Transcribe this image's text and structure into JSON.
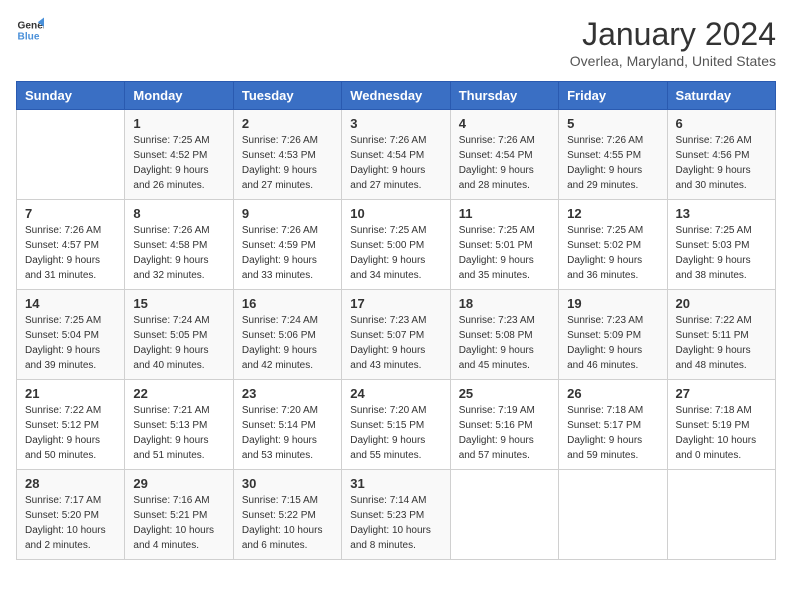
{
  "logo": {
    "line1": "General",
    "line2": "Blue"
  },
  "title": "January 2024",
  "subtitle": "Overlea, Maryland, United States",
  "days_of_week": [
    "Sunday",
    "Monday",
    "Tuesday",
    "Wednesday",
    "Thursday",
    "Friday",
    "Saturday"
  ],
  "weeks": [
    [
      {
        "day": "",
        "info": ""
      },
      {
        "day": "1",
        "info": "Sunrise: 7:25 AM\nSunset: 4:52 PM\nDaylight: 9 hours\nand 26 minutes."
      },
      {
        "day": "2",
        "info": "Sunrise: 7:26 AM\nSunset: 4:53 PM\nDaylight: 9 hours\nand 27 minutes."
      },
      {
        "day": "3",
        "info": "Sunrise: 7:26 AM\nSunset: 4:54 PM\nDaylight: 9 hours\nand 27 minutes."
      },
      {
        "day": "4",
        "info": "Sunrise: 7:26 AM\nSunset: 4:54 PM\nDaylight: 9 hours\nand 28 minutes."
      },
      {
        "day": "5",
        "info": "Sunrise: 7:26 AM\nSunset: 4:55 PM\nDaylight: 9 hours\nand 29 minutes."
      },
      {
        "day": "6",
        "info": "Sunrise: 7:26 AM\nSunset: 4:56 PM\nDaylight: 9 hours\nand 30 minutes."
      }
    ],
    [
      {
        "day": "7",
        "info": "Sunrise: 7:26 AM\nSunset: 4:57 PM\nDaylight: 9 hours\nand 31 minutes."
      },
      {
        "day": "8",
        "info": "Sunrise: 7:26 AM\nSunset: 4:58 PM\nDaylight: 9 hours\nand 32 minutes."
      },
      {
        "day": "9",
        "info": "Sunrise: 7:26 AM\nSunset: 4:59 PM\nDaylight: 9 hours\nand 33 minutes."
      },
      {
        "day": "10",
        "info": "Sunrise: 7:25 AM\nSunset: 5:00 PM\nDaylight: 9 hours\nand 34 minutes."
      },
      {
        "day": "11",
        "info": "Sunrise: 7:25 AM\nSunset: 5:01 PM\nDaylight: 9 hours\nand 35 minutes."
      },
      {
        "day": "12",
        "info": "Sunrise: 7:25 AM\nSunset: 5:02 PM\nDaylight: 9 hours\nand 36 minutes."
      },
      {
        "day": "13",
        "info": "Sunrise: 7:25 AM\nSunset: 5:03 PM\nDaylight: 9 hours\nand 38 minutes."
      }
    ],
    [
      {
        "day": "14",
        "info": "Sunrise: 7:25 AM\nSunset: 5:04 PM\nDaylight: 9 hours\nand 39 minutes."
      },
      {
        "day": "15",
        "info": "Sunrise: 7:24 AM\nSunset: 5:05 PM\nDaylight: 9 hours\nand 40 minutes."
      },
      {
        "day": "16",
        "info": "Sunrise: 7:24 AM\nSunset: 5:06 PM\nDaylight: 9 hours\nand 42 minutes."
      },
      {
        "day": "17",
        "info": "Sunrise: 7:23 AM\nSunset: 5:07 PM\nDaylight: 9 hours\nand 43 minutes."
      },
      {
        "day": "18",
        "info": "Sunrise: 7:23 AM\nSunset: 5:08 PM\nDaylight: 9 hours\nand 45 minutes."
      },
      {
        "day": "19",
        "info": "Sunrise: 7:23 AM\nSunset: 5:09 PM\nDaylight: 9 hours\nand 46 minutes."
      },
      {
        "day": "20",
        "info": "Sunrise: 7:22 AM\nSunset: 5:11 PM\nDaylight: 9 hours\nand 48 minutes."
      }
    ],
    [
      {
        "day": "21",
        "info": "Sunrise: 7:22 AM\nSunset: 5:12 PM\nDaylight: 9 hours\nand 50 minutes."
      },
      {
        "day": "22",
        "info": "Sunrise: 7:21 AM\nSunset: 5:13 PM\nDaylight: 9 hours\nand 51 minutes."
      },
      {
        "day": "23",
        "info": "Sunrise: 7:20 AM\nSunset: 5:14 PM\nDaylight: 9 hours\nand 53 minutes."
      },
      {
        "day": "24",
        "info": "Sunrise: 7:20 AM\nSunset: 5:15 PM\nDaylight: 9 hours\nand 55 minutes."
      },
      {
        "day": "25",
        "info": "Sunrise: 7:19 AM\nSunset: 5:16 PM\nDaylight: 9 hours\nand 57 minutes."
      },
      {
        "day": "26",
        "info": "Sunrise: 7:18 AM\nSunset: 5:17 PM\nDaylight: 9 hours\nand 59 minutes."
      },
      {
        "day": "27",
        "info": "Sunrise: 7:18 AM\nSunset: 5:19 PM\nDaylight: 10 hours\nand 0 minutes."
      }
    ],
    [
      {
        "day": "28",
        "info": "Sunrise: 7:17 AM\nSunset: 5:20 PM\nDaylight: 10 hours\nand 2 minutes."
      },
      {
        "day": "29",
        "info": "Sunrise: 7:16 AM\nSunset: 5:21 PM\nDaylight: 10 hours\nand 4 minutes."
      },
      {
        "day": "30",
        "info": "Sunrise: 7:15 AM\nSunset: 5:22 PM\nDaylight: 10 hours\nand 6 minutes."
      },
      {
        "day": "31",
        "info": "Sunrise: 7:14 AM\nSunset: 5:23 PM\nDaylight: 10 hours\nand 8 minutes."
      },
      {
        "day": "",
        "info": ""
      },
      {
        "day": "",
        "info": ""
      },
      {
        "day": "",
        "info": ""
      }
    ]
  ]
}
